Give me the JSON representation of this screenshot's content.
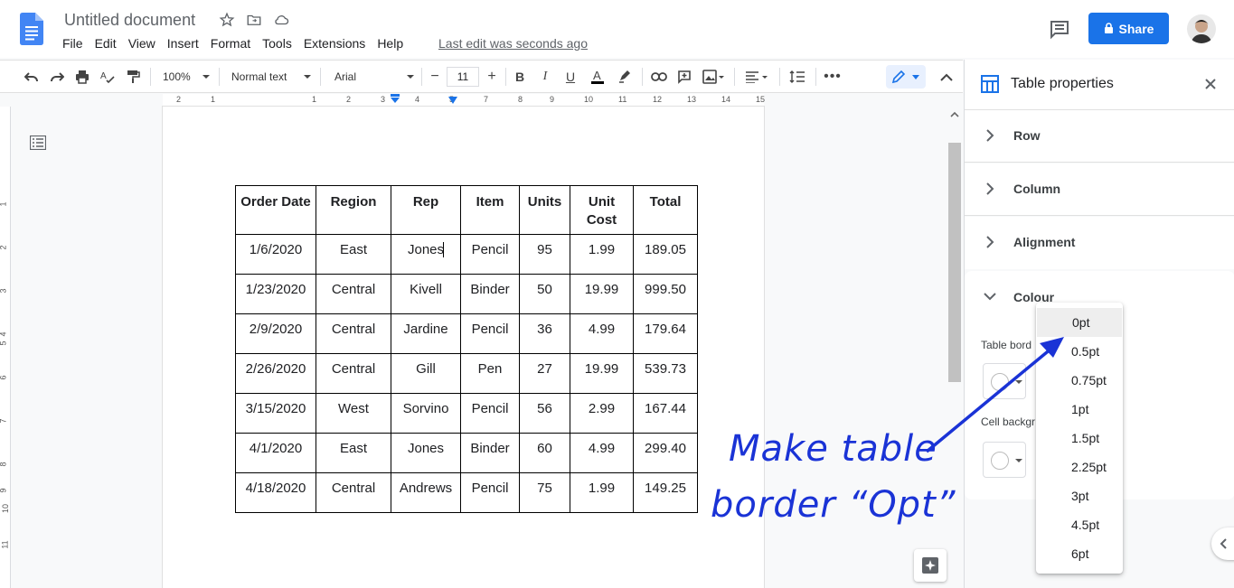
{
  "app": {
    "doc_title": "Untitled document",
    "last_edit": "Last edit was seconds ago",
    "share_label": "Share"
  },
  "menu": [
    "File",
    "Edit",
    "View",
    "Insert",
    "Format",
    "Tools",
    "Extensions",
    "Help"
  ],
  "toolbar": {
    "zoom": "100%",
    "style": "Normal text",
    "font": "Arial",
    "font_size": "11"
  },
  "ruler": {
    "numbers": [
      "2",
      "1",
      "1",
      "2",
      "3",
      "4",
      "5",
      "6",
      "7",
      "8",
      "9",
      "10",
      "11",
      "12",
      "13",
      "14",
      "15"
    ],
    "vertical_numbers": [
      "1",
      "2",
      "3",
      "4",
      "5",
      "6",
      "7",
      "8",
      "9",
      "10",
      "11"
    ]
  },
  "table": {
    "headers": [
      "Order Date",
      "Region",
      "Rep",
      "Item",
      "Units",
      "Unit Cost",
      "Total"
    ],
    "rows": [
      [
        "1/6/2020",
        "East",
        "Jones",
        "Pencil",
        "95",
        "1.99",
        "189.05"
      ],
      [
        "1/23/2020",
        "Central",
        "Kivell",
        "Binder",
        "50",
        "19.99",
        "999.50"
      ],
      [
        "2/9/2020",
        "Central",
        "Jardine",
        "Pencil",
        "36",
        "4.99",
        "179.64"
      ],
      [
        "2/26/2020",
        "Central",
        "Gill",
        "Pen",
        "27",
        "19.99",
        "539.73"
      ],
      [
        "3/15/2020",
        "West",
        "Sorvino",
        "Pencil",
        "56",
        "2.99",
        "167.44"
      ],
      [
        "4/1/2020",
        "East",
        "Jones",
        "Binder",
        "60",
        "4.99",
        "299.40"
      ],
      [
        "4/18/2020",
        "Central",
        "Andrews",
        "Pencil",
        "75",
        "1.99",
        "149.25"
      ]
    ]
  },
  "side_panel": {
    "title": "Table properties",
    "sections": [
      "Row",
      "Column",
      "Alignment"
    ],
    "colour_label": "Colour",
    "table_border_label": "Table bord",
    "cell_bg_label": "Cell backgr"
  },
  "border_dropdown": {
    "options": [
      "0pt",
      "0.5pt",
      "0.75pt",
      "1pt",
      "1.5pt",
      "2.25pt",
      "3pt",
      "4.5pt",
      "6pt"
    ],
    "highlighted": "0pt"
  },
  "annotation": {
    "line1": "Make table",
    "line2": "border “Opt”"
  },
  "colors": {
    "accent": "#1a73e8",
    "annotation": "#1a33d6"
  }
}
